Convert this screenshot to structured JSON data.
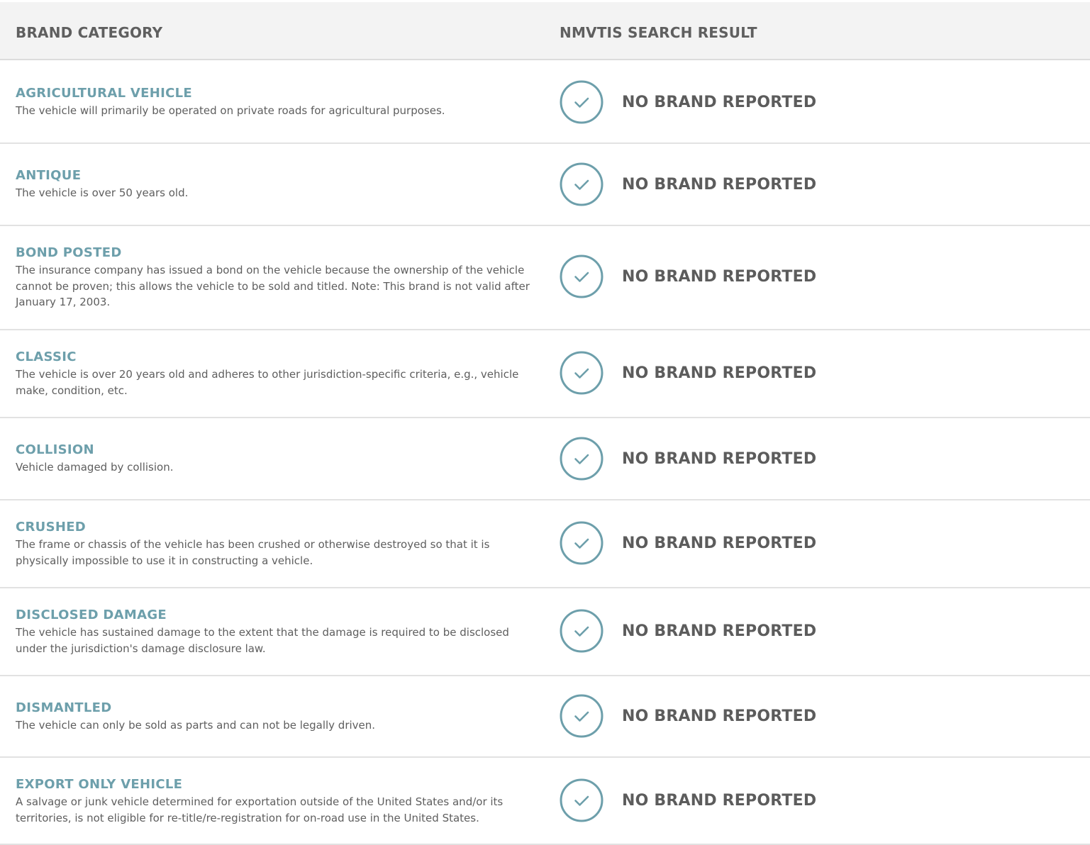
{
  "header": {
    "brand_category": "BRAND CATEGORY",
    "search_result": "NMVTIS SEARCH RESULT"
  },
  "colors": {
    "accent": "#6d9fab",
    "header_bg": "#f3f3f3",
    "text": "#5e5e5e"
  },
  "rows": [
    {
      "name": "AGRICULTURAL VEHICLE",
      "description": "The vehicle will primarily be operated on private roads for agricultural purposes.",
      "result": "NO BRAND REPORTED",
      "icon": "check-circle-icon"
    },
    {
      "name": "ANTIQUE",
      "description": "The vehicle is over 50 years old.",
      "result": "NO BRAND REPORTED",
      "icon": "check-circle-icon"
    },
    {
      "name": "BOND POSTED",
      "description": "The insurance company has issued a bond on the vehicle because the ownership of the vehicle cannot be proven; this allows the vehicle to be sold and titled. Note: This brand is not valid after January 17, 2003.",
      "result": "NO BRAND REPORTED",
      "icon": "check-circle-icon"
    },
    {
      "name": "CLASSIC",
      "description": "The vehicle is over 20 years old and adheres to other jurisdiction-specific criteria, e.g., vehicle make, condition, etc.",
      "result": "NO BRAND REPORTED",
      "icon": "check-circle-icon"
    },
    {
      "name": "COLLISION",
      "description": "Vehicle damaged by collision.",
      "result": "NO BRAND REPORTED",
      "icon": "check-circle-icon"
    },
    {
      "name": "CRUSHED",
      "description": "The frame or chassis of the vehicle has been crushed or otherwise destroyed so that it is physically impossible to use it in constructing a vehicle.",
      "result": "NO BRAND REPORTED",
      "icon": "check-circle-icon"
    },
    {
      "name": "DISCLOSED DAMAGE",
      "description": "The vehicle has sustained damage to the extent that the damage is required to be disclosed under the jurisdiction's damage disclosure law.",
      "result": "NO BRAND REPORTED",
      "icon": "check-circle-icon"
    },
    {
      "name": "DISMANTLED",
      "description": "The vehicle can only be sold as parts and can not be legally driven.",
      "result": "NO BRAND REPORTED",
      "icon": "check-circle-icon"
    },
    {
      "name": "EXPORT ONLY VEHICLE",
      "description": "A salvage or junk vehicle determined for exportation outside of the United States and/or its territories, is not eligible for re-title/re-registration for on-road use in the United States.",
      "result": "NO BRAND REPORTED",
      "icon": "check-circle-icon"
    }
  ]
}
